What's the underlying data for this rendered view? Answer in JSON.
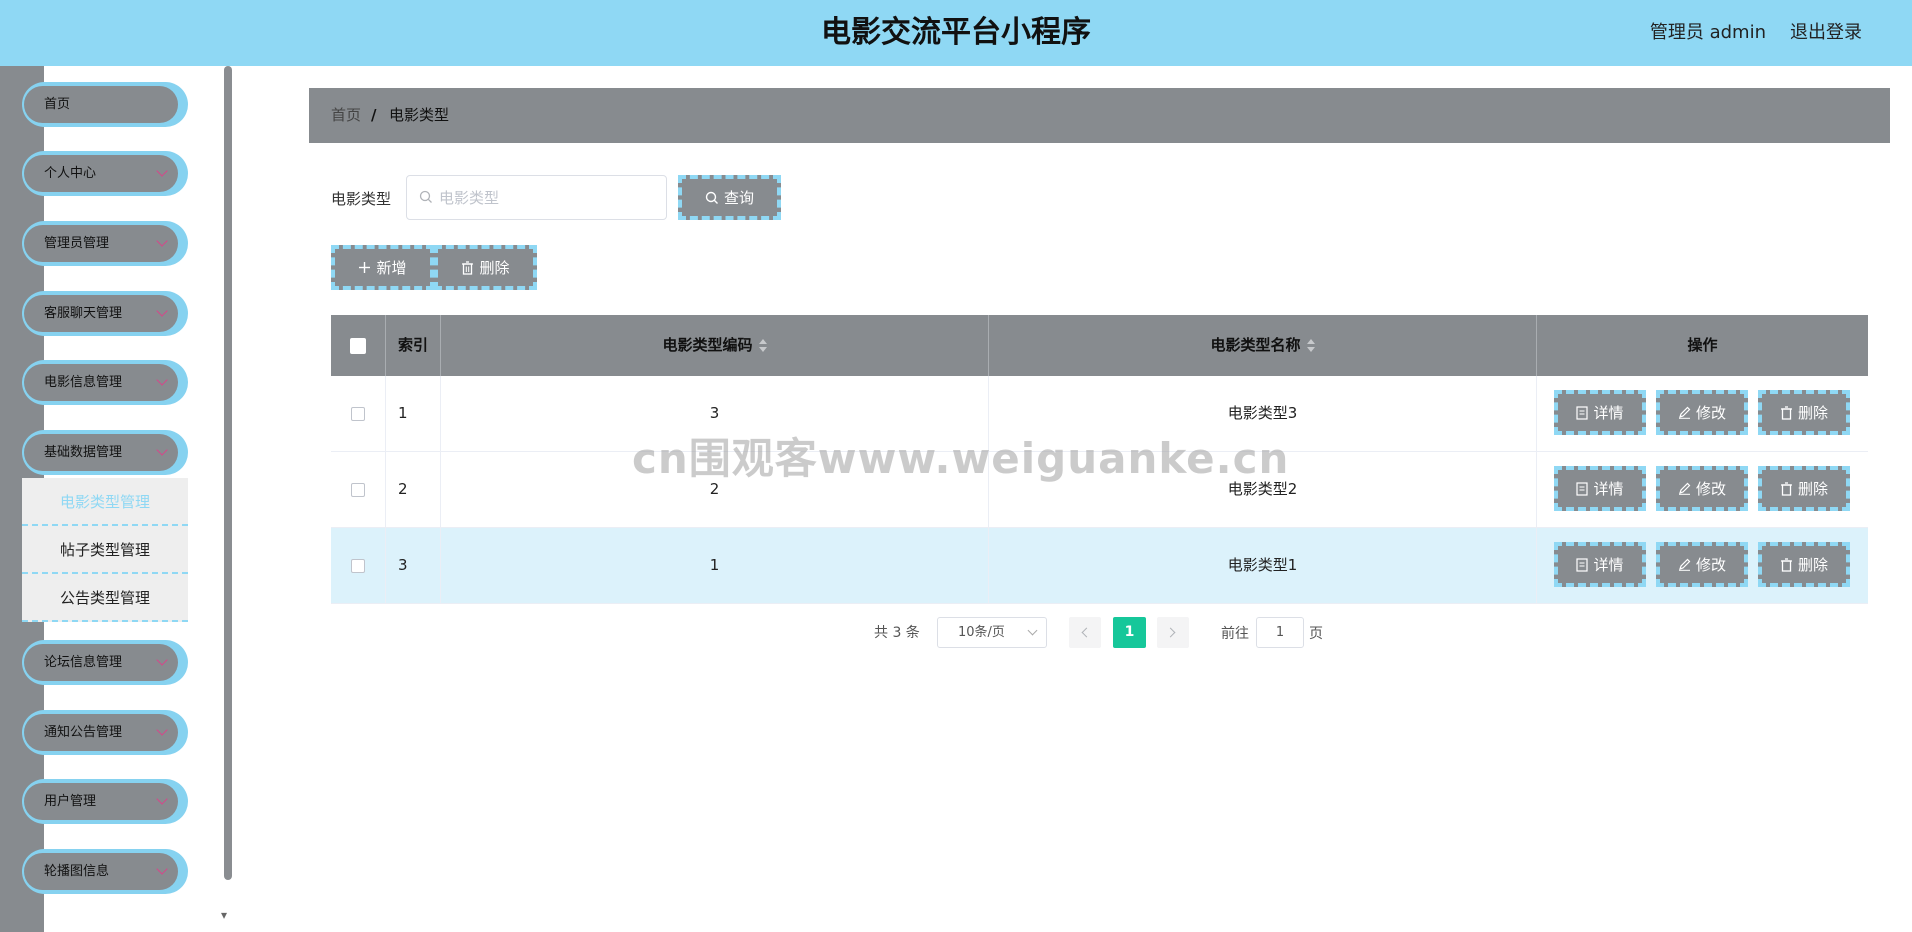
{
  "header": {
    "title": "电影交流平台小程序",
    "user": "管理员 admin",
    "logout": "退出登录"
  },
  "sidebar": {
    "items": [
      {
        "label": "首页",
        "has_chevron": false
      },
      {
        "label": "个人中心",
        "has_chevron": true
      },
      {
        "label": "管理员管理",
        "has_chevron": true
      },
      {
        "label": "客服聊天管理",
        "has_chevron": true
      },
      {
        "label": "电影信息管理",
        "has_chevron": true
      },
      {
        "label": "基础数据管理",
        "has_chevron": true,
        "expanded": true
      },
      {
        "label": "论坛信息管理",
        "has_chevron": true
      },
      {
        "label": "通知公告管理",
        "has_chevron": true
      },
      {
        "label": "用户管理",
        "has_chevron": true
      },
      {
        "label": "轮播图信息",
        "has_chevron": true
      }
    ],
    "submenu": [
      {
        "label": "电影类型管理",
        "active": true
      },
      {
        "label": "帖子类型管理",
        "active": false
      },
      {
        "label": "公告类型管理",
        "active": false
      }
    ]
  },
  "breadcrumb": {
    "home": "首页",
    "separator": "/",
    "current": "电影类型"
  },
  "search": {
    "label": "电影类型",
    "placeholder": "电影类型",
    "value": "",
    "query_button": "查询"
  },
  "actions": {
    "add": "新增",
    "delete": "删除"
  },
  "table": {
    "columns": [
      "索引",
      "电影类型编码",
      "电影类型名称",
      "操作"
    ],
    "rows": [
      {
        "index": "1",
        "code": "3",
        "name": "电影类型3",
        "highlighted": false
      },
      {
        "index": "2",
        "code": "2",
        "name": "电影类型2",
        "highlighted": false
      },
      {
        "index": "3",
        "code": "1",
        "name": "电影类型1",
        "highlighted": true
      }
    ],
    "row_actions": {
      "detail": "详情",
      "edit": "修改",
      "delete": "删除"
    }
  },
  "pagination": {
    "total_text": "共 3 条",
    "page_size": "10条/页",
    "current_page": "1",
    "goto_label": "前往",
    "goto_value": "1",
    "goto_unit": "页"
  },
  "watermark": "cn围观客www.weiguanke.cn",
  "colors": {
    "header_bg": "#8fd8f4",
    "accent_gray": "#878b8f",
    "dashed_border": "#8fd8f4",
    "page_active": "#16c79a",
    "row_highlight": "#dcf2fb",
    "chevron": "#d7468a"
  }
}
